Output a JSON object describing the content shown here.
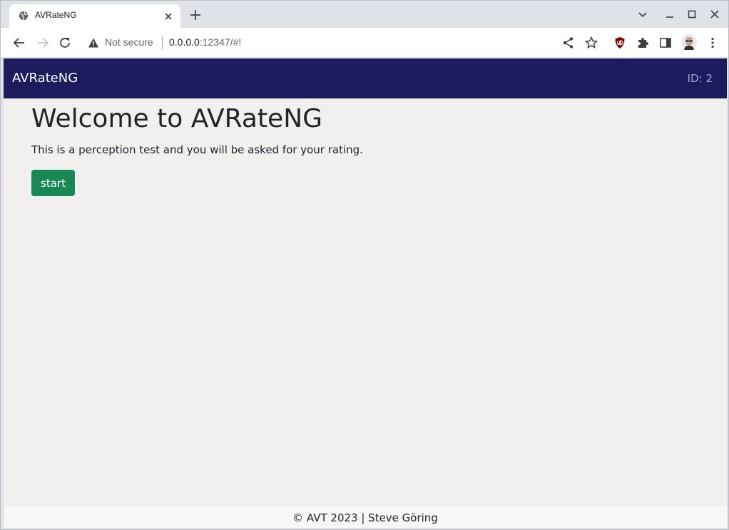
{
  "browser": {
    "tab_title": "AVRateNG",
    "security_label": "Not secure",
    "url_host": "0.0.0.0",
    "url_rest": ":12347/#!"
  },
  "icons": {
    "favicon": "globe-icon",
    "tab_close": "close-icon",
    "new_tab": "plus-icon",
    "back": "arrow-left-icon",
    "forward": "arrow-right-icon",
    "reload": "reload-icon",
    "security": "warning-triangle-icon",
    "share": "share-icon",
    "bookmark": "star-icon",
    "ublock": "ublock-origin-icon",
    "extensions": "puzzle-icon",
    "side_panel": "side-panel-icon",
    "profile": "avatar",
    "menu": "kebab-menu-icon"
  },
  "colors": {
    "navbar": "#1c1b5e",
    "start_button": "#198754",
    "page_background": "#f1f0ef"
  },
  "app": {
    "brand": "AVRateNG",
    "session_id": "ID: 2",
    "heading": "Welcome to AVRateNG",
    "intro": "This is a perception test and you will be asked for your rating.",
    "start_label": "start",
    "footer": "© AVT 2023 | Steve Göring"
  }
}
